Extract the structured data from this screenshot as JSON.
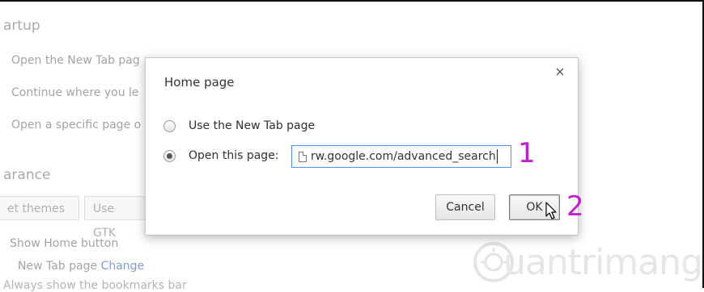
{
  "background": {
    "startup_title": "artup",
    "startup_options": [
      "Open the New Tab pag",
      "Continue where you le",
      "Open a specific page o"
    ],
    "appearance_title": "arance",
    "themes_button": "et themes",
    "gtk_button": "Use GTK",
    "show_home_label": "Show Home button",
    "ntp_text": "New Tab page",
    "change_link": "Change",
    "cut_text": "Always show the bookmarks bar"
  },
  "dialog": {
    "title": "Home page",
    "close_glyph": "×",
    "option_new_tab": "Use the New Tab page",
    "option_open_page": "Open this page:",
    "url_value": "rw.google.com/advanced_search",
    "selected_option": "open_page",
    "cancel_label": "Cancel",
    "ok_label": "OK"
  },
  "annotations": {
    "step1": "1",
    "step2": "2"
  },
  "watermark": {
    "text": "uantrimang"
  },
  "colors": {
    "annotation": "#c020d0",
    "focus_border": "#4d90fe",
    "link": "#7e9bd8"
  }
}
